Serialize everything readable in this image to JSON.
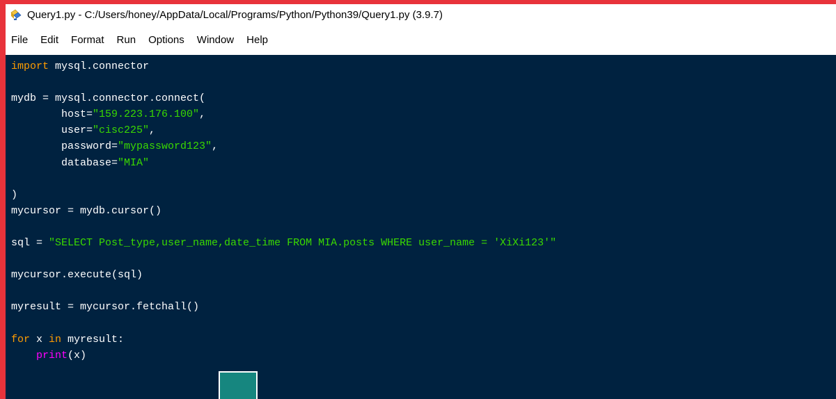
{
  "window": {
    "title": "Query1.py - C:/Users/honey/AppData/Local/Programs/Python/Python39/Query1.py (3.9.7)",
    "icon": "python-file-icon"
  },
  "menu": {
    "items": [
      {
        "label": "File"
      },
      {
        "label": "Edit"
      },
      {
        "label": "Format"
      },
      {
        "label": "Run"
      },
      {
        "label": "Options"
      },
      {
        "label": "Window"
      },
      {
        "label": "Help"
      }
    ]
  },
  "colors": {
    "editor_background": "#002240",
    "keyword": "#ff9d00",
    "string": "#3ad900",
    "builtin": "#ff00ff",
    "default_text": "#ffffff",
    "frame": "#e8333b"
  },
  "code": {
    "lines": [
      [
        {
          "t": "import",
          "c": "kw"
        },
        {
          "t": " mysql.connector",
          "c": ""
        }
      ],
      [],
      [
        {
          "t": "mydb = mysql.connector.connect(",
          "c": ""
        }
      ],
      [
        {
          "t": "        host=",
          "c": ""
        },
        {
          "t": "\"159.223.176.100\"",
          "c": "str"
        },
        {
          "t": ",",
          "c": ""
        }
      ],
      [
        {
          "t": "        user=",
          "c": ""
        },
        {
          "t": "\"cisc225\"",
          "c": "str"
        },
        {
          "t": ",",
          "c": ""
        }
      ],
      [
        {
          "t": "        password=",
          "c": ""
        },
        {
          "t": "\"mypassword123\"",
          "c": "str"
        },
        {
          "t": ",",
          "c": ""
        }
      ],
      [
        {
          "t": "        database=",
          "c": ""
        },
        {
          "t": "\"MIA\"",
          "c": "str"
        }
      ],
      [],
      [
        {
          "t": ")",
          "c": ""
        }
      ],
      [
        {
          "t": "mycursor = mydb.cursor()",
          "c": ""
        }
      ],
      [],
      [
        {
          "t": "sql = ",
          "c": ""
        },
        {
          "t": "\"SELECT Post_type,user_name,date_time FROM MIA.posts WHERE user_name = 'XiXi123'\"",
          "c": "str"
        }
      ],
      [],
      [
        {
          "t": "mycursor.execute(sql)",
          "c": ""
        }
      ],
      [],
      [
        {
          "t": "myresult = mycursor.fetchall()",
          "c": ""
        }
      ],
      [],
      [
        {
          "t": "for",
          "c": "kw"
        },
        {
          "t": " x ",
          "c": ""
        },
        {
          "t": "in",
          "c": "kw"
        },
        {
          "t": " myresult:",
          "c": ""
        }
      ],
      [
        {
          "t": "    ",
          "c": ""
        },
        {
          "t": "print",
          "c": "bi"
        },
        {
          "t": "(x)",
          "c": ""
        }
      ]
    ]
  }
}
